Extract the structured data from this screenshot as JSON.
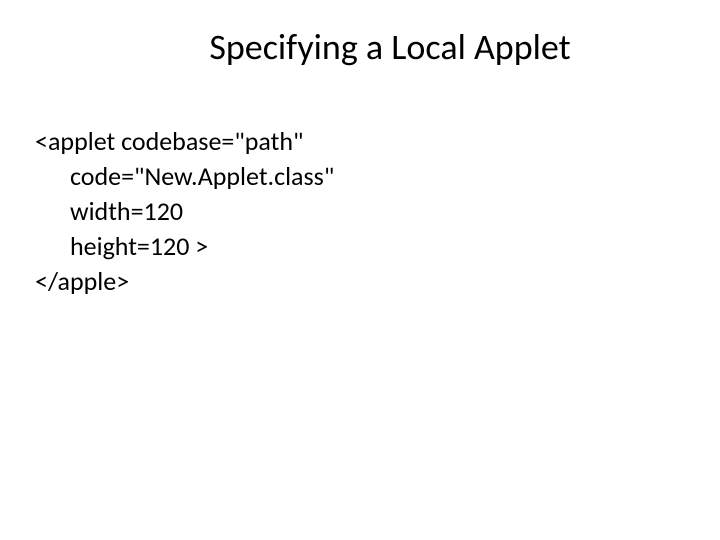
{
  "title": "Specifying a Local Applet",
  "code": {
    "line1": "<applet codebase=\"path\"",
    "line2": "code=\"New.Applet.class\"",
    "line3": "width=120",
    "line4": "height=120 >",
    "line5": "</apple>"
  }
}
